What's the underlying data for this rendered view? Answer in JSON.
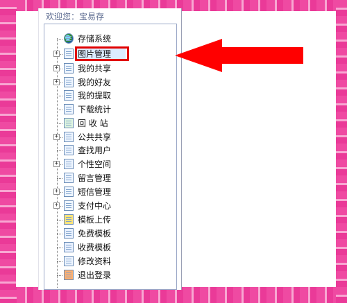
{
  "welcome_text": "欢迎您：宝易存",
  "tree": [
    {
      "label": "存储系统",
      "expandable": false,
      "icon": "globe-icon",
      "selected": false
    },
    {
      "label": "图片管理",
      "expandable": true,
      "icon": "document-icon",
      "selected": true
    },
    {
      "label": "我的共享",
      "expandable": true,
      "icon": "share-folder-icon",
      "selected": false
    },
    {
      "label": "我的好友",
      "expandable": true,
      "icon": "friends-icon",
      "selected": false
    },
    {
      "label": "我的提取",
      "expandable": false,
      "icon": "download-doc-icon",
      "selected": false
    },
    {
      "label": "下载统计",
      "expandable": false,
      "icon": "document-icon",
      "selected": false
    },
    {
      "label": "回 收 站",
      "expandable": false,
      "icon": "recycle-bin-icon",
      "selected": false
    },
    {
      "label": "公共共享",
      "expandable": true,
      "icon": "share-folder-icon",
      "selected": false
    },
    {
      "label": "查找用户",
      "expandable": false,
      "icon": "user-search-icon",
      "selected": false
    },
    {
      "label": "个性空间",
      "expandable": true,
      "icon": "space-icon",
      "selected": false
    },
    {
      "label": "留言管理",
      "expandable": false,
      "icon": "message-icon",
      "selected": false
    },
    {
      "label": "短信管理",
      "expandable": true,
      "icon": "sms-icon",
      "selected": false
    },
    {
      "label": "支付中心",
      "expandable": true,
      "icon": "payment-icon",
      "selected": false
    },
    {
      "label": "模板上传",
      "expandable": false,
      "icon": "upload-icon",
      "selected": false
    },
    {
      "label": "免费模板",
      "expandable": false,
      "icon": "template-grid-icon",
      "selected": false
    },
    {
      "label": "收费模板",
      "expandable": false,
      "icon": "template-grid-icon",
      "selected": false
    },
    {
      "label": "修改资料",
      "expandable": false,
      "icon": "edit-profile-icon",
      "selected": false
    },
    {
      "label": "退出登录",
      "expandable": false,
      "icon": "logout-icon",
      "selected": false
    }
  ],
  "colors": {
    "frame": "#ea3a98",
    "highlight_box": "#e10000",
    "arrow": "#ff0000",
    "tree_border": "#9aa7c7"
  }
}
